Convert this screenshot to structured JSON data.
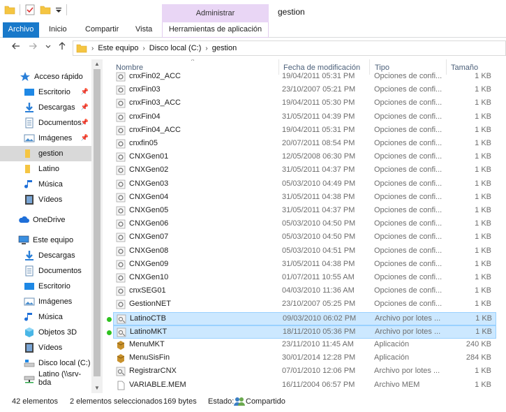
{
  "window": {
    "title": "gestion",
    "manage_tab": "Administrar",
    "app_tools_tab": "Herramientas de aplicación"
  },
  "ribbon": {
    "tabs": [
      "Archivo",
      "Inicio",
      "Compartir",
      "Vista"
    ]
  },
  "address": {
    "crumbs": [
      "Este equipo",
      "Disco local (C:)",
      "gestion"
    ]
  },
  "sidebar": {
    "quick_access": "Acceso rápido",
    "items": [
      {
        "label": "Escritorio",
        "icon": "desktop-icon",
        "pinned": true
      },
      {
        "label": "Descargas",
        "icon": "download-icon",
        "pinned": true
      },
      {
        "label": "Documentos",
        "icon": "documents-icon",
        "pinned": true
      },
      {
        "label": "Imágenes",
        "icon": "pictures-icon",
        "pinned": true
      },
      {
        "label": "gestion",
        "icon": "folder-icon",
        "pinned": false,
        "selected": true
      },
      {
        "label": "Latino",
        "icon": "folder-icon",
        "pinned": false
      },
      {
        "label": "Música",
        "icon": "music-icon",
        "pinned": false
      },
      {
        "label": "Vídeos",
        "icon": "videos-icon",
        "pinned": false
      }
    ],
    "onedrive": "OneDrive",
    "this_pc": "Este equipo",
    "pc_items": [
      {
        "label": "Descargas",
        "icon": "download-icon"
      },
      {
        "label": "Documentos",
        "icon": "documents-icon"
      },
      {
        "label": "Escritorio",
        "icon": "desktop-icon"
      },
      {
        "label": "Imágenes",
        "icon": "pictures-icon"
      },
      {
        "label": "Música",
        "icon": "music-icon"
      },
      {
        "label": "Objetos 3D",
        "icon": "objects3d-icon"
      },
      {
        "label": "Vídeos",
        "icon": "videos-icon"
      },
      {
        "label": "Disco local (C:)",
        "icon": "drive-icon"
      },
      {
        "label": "Latino (\\\\srv-bda",
        "icon": "network-drive-icon"
      }
    ]
  },
  "columns": {
    "name": "Nombre",
    "date": "Fecha de modificación",
    "type": "Tipo",
    "size": "Tamaño"
  },
  "files": [
    {
      "name": "cnxFin02_ACC",
      "date": "19/04/2011 05:31 PM",
      "type": "Opciones de confi...",
      "size": "1 KB",
      "icon": "config-file-icon"
    },
    {
      "name": "cnxFin03",
      "date": "23/10/2007 05:21 PM",
      "type": "Opciones de confi...",
      "size": "1 KB",
      "icon": "config-file-icon"
    },
    {
      "name": "cnxFin03_ACC",
      "date": "19/04/2011 05:30 PM",
      "type": "Opciones de confi...",
      "size": "1 KB",
      "icon": "config-file-icon"
    },
    {
      "name": "cnxFin04",
      "date": "31/05/2011 04:39 PM",
      "type": "Opciones de confi...",
      "size": "1 KB",
      "icon": "config-file-icon"
    },
    {
      "name": "cnxFin04_ACC",
      "date": "19/04/2011 05:31 PM",
      "type": "Opciones de confi...",
      "size": "1 KB",
      "icon": "config-file-icon"
    },
    {
      "name": "cnxfin05",
      "date": "20/07/2011 08:54 PM",
      "type": "Opciones de confi...",
      "size": "1 KB",
      "icon": "config-file-icon"
    },
    {
      "name": "CNXGen01",
      "date": "12/05/2008 06:30 PM",
      "type": "Opciones de confi...",
      "size": "1 KB",
      "icon": "config-file-icon"
    },
    {
      "name": "CNXGen02",
      "date": "31/05/2011 04:37 PM",
      "type": "Opciones de confi...",
      "size": "1 KB",
      "icon": "config-file-icon"
    },
    {
      "name": "CNXGen03",
      "date": "05/03/2010 04:49 PM",
      "type": "Opciones de confi...",
      "size": "1 KB",
      "icon": "config-file-icon"
    },
    {
      "name": "CNXGen04",
      "date": "31/05/2011 04:38 PM",
      "type": "Opciones de confi...",
      "size": "1 KB",
      "icon": "config-file-icon"
    },
    {
      "name": "CNXGen05",
      "date": "31/05/2011 04:37 PM",
      "type": "Opciones de confi...",
      "size": "1 KB",
      "icon": "config-file-icon"
    },
    {
      "name": "CNXGen06",
      "date": "05/03/2010 04:50 PM",
      "type": "Opciones de confi...",
      "size": "1 KB",
      "icon": "config-file-icon"
    },
    {
      "name": "CNXGen07",
      "date": "05/03/2010 04:50 PM",
      "type": "Opciones de confi...",
      "size": "1 KB",
      "icon": "config-file-icon"
    },
    {
      "name": "CNXGen08",
      "date": "05/03/2010 04:51 PM",
      "type": "Opciones de confi...",
      "size": "1 KB",
      "icon": "config-file-icon"
    },
    {
      "name": "CNXGen09",
      "date": "31/05/2011 04:38 PM",
      "type": "Opciones de confi...",
      "size": "1 KB",
      "icon": "config-file-icon"
    },
    {
      "name": "CNXGen10",
      "date": "01/07/2011 10:55 AM",
      "type": "Opciones de confi...",
      "size": "1 KB",
      "icon": "config-file-icon"
    },
    {
      "name": "cnxSEG01",
      "date": "04/03/2010 11:36 AM",
      "type": "Opciones de confi...",
      "size": "1 KB",
      "icon": "config-file-icon"
    },
    {
      "name": "GestionNET",
      "date": "23/10/2007 05:25 PM",
      "type": "Opciones de confi...",
      "size": "1 KB",
      "icon": "config-file-icon"
    },
    {
      "name": "LatinoCTB",
      "date": "09/03/2010 06:02 PM",
      "type": "Archivo por lotes ...",
      "size": "1 KB",
      "icon": "batch-file-icon",
      "selected": true
    },
    {
      "name": "LatinoMKT",
      "date": "18/11/2010 05:36 PM",
      "type": "Archivo por lotes ...",
      "size": "1 KB",
      "icon": "batch-file-icon",
      "selected": true
    },
    {
      "name": "MenuMKT",
      "date": "23/11/2010 11:45 AM",
      "type": "Aplicación",
      "size": "240 KB",
      "icon": "application-icon"
    },
    {
      "name": "MenuSisFin",
      "date": "30/01/2014 12:28 PM",
      "type": "Aplicación",
      "size": "284 KB",
      "icon": "application-icon"
    },
    {
      "name": "RegistrarCNX",
      "date": "07/01/2010 12:06 PM",
      "type": "Archivo por lotes ...",
      "size": "1 KB",
      "icon": "batch-file-icon"
    },
    {
      "name": "VARIABLE.MEM",
      "date": "16/11/2004 06:57 PM",
      "type": "Archivo MEM",
      "size": "1 KB",
      "icon": "generic-file-icon"
    }
  ],
  "status": {
    "count": "42 elementos",
    "selected": "2 elementos seleccionados",
    "size": "169 bytes",
    "state_label": "Estado:",
    "state_value": "Compartido"
  },
  "colors": {
    "accent": "#1979ca",
    "selection": "#cce8ff",
    "manage": "#e9d6f5",
    "sync_dot": "#2ec21f"
  }
}
